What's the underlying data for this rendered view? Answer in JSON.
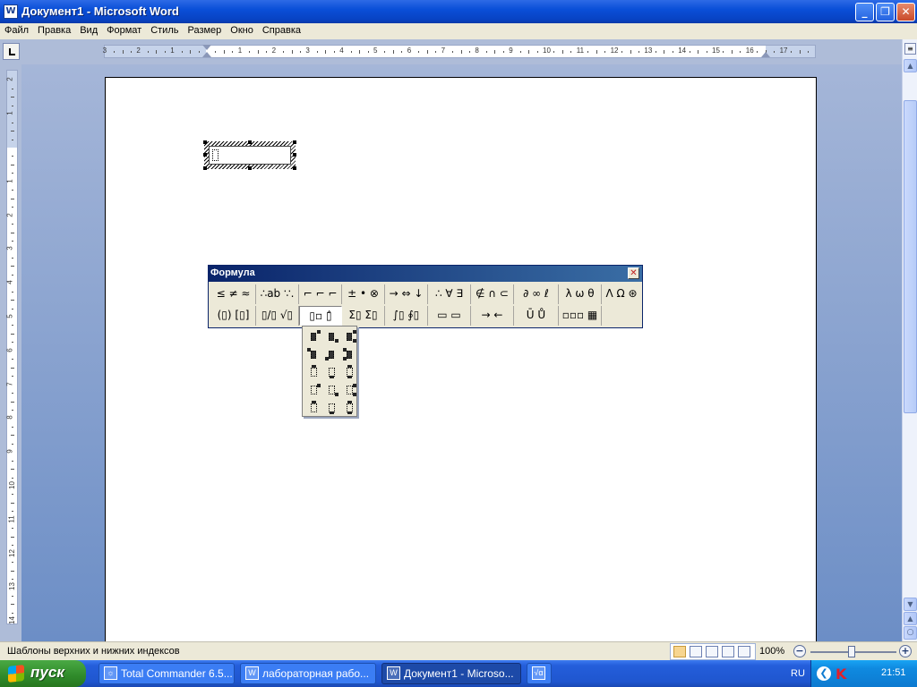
{
  "window": {
    "title": "Документ1 - Microsoft Word",
    "app_icon": "word-doc-icon",
    "controls": {
      "minimize": "_",
      "restore": "❐",
      "close": "✕"
    }
  },
  "menu": [
    "Файл",
    "Правка",
    "Вид",
    "Формат",
    "Стиль",
    "Размер",
    "Окно",
    "Справка"
  ],
  "ruler": {
    "horizontal_labels": [
      "3",
      "2",
      "1",
      "1",
      "2",
      "3",
      "4",
      "5",
      "6",
      "7",
      "8",
      "9",
      "10",
      "11",
      "12",
      "13",
      "14",
      "15",
      "16",
      "17"
    ],
    "vertical_labels": [
      "2",
      "1",
      "1",
      "2",
      "3",
      "4",
      "5",
      "6",
      "7",
      "8",
      "9",
      "10",
      "11",
      "12",
      "13",
      "14"
    ]
  },
  "palette": {
    "title": "Формула",
    "close": "✕",
    "row1": [
      "≤ ≠ ≈",
      "∴ab ∵.",
      "⌐ ⌐ ⌐",
      "± • ⊗",
      "→ ⇔ ↓",
      "∴ ∀ ∃",
      "∉ ∩ ⊂",
      "∂ ∞ ℓ",
      "λ ω θ",
      "Λ Ω ⊛"
    ],
    "row2": [
      "(▯) [▯]",
      "▯/▯ √▯",
      "▯▫ ▯̂",
      "Σ▯ Σ▯",
      "∫▯ ∮▯",
      "▭ ▭",
      "→ ←",
      "Ū Ů",
      "▫▫▫ ▦"
    ],
    "active_index": 2
  },
  "status": {
    "text": "Шаблоны верхних и нижних индексов",
    "zoom": "100%",
    "zoom_level_percent": 100,
    "zoom_out": "−",
    "zoom_in": "+"
  },
  "taskbar": {
    "start": "пуск",
    "tasks": [
      {
        "label": "Total Commander 6.5...",
        "icon": "total-commander-icon"
      },
      {
        "label": "лабораторная рабо...",
        "icon": "word-doc-icon"
      },
      {
        "label": "Документ1 - Microso...",
        "icon": "word-doc-icon",
        "active": true
      },
      {
        "label": "",
        "icon": "equation-editor-icon"
      }
    ],
    "lang": "RU",
    "clock": "21:51"
  }
}
